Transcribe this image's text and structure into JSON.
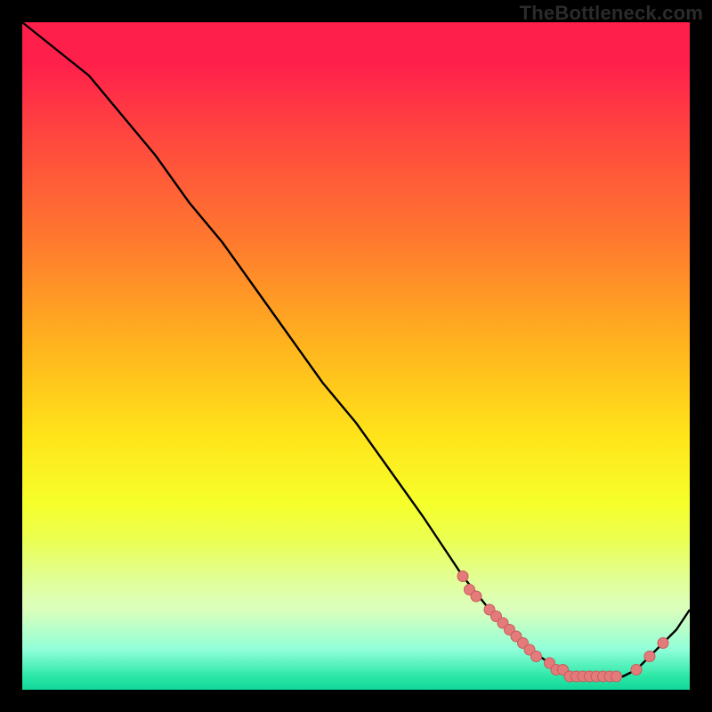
{
  "watermark": "TheBottleneck.com",
  "colors": {
    "curve": "#000000",
    "marker_fill": "#e47b7b",
    "marker_stroke": "#c95c5c"
  },
  "chart_data": {
    "type": "line",
    "title": "",
    "xlabel": "",
    "ylabel": "",
    "xlim": [
      0,
      100
    ],
    "ylim": [
      0,
      100
    ],
    "series": [
      {
        "name": "curve",
        "x": [
          0,
          5,
          10,
          15,
          20,
          25,
          30,
          35,
          40,
          45,
          50,
          55,
          60,
          62,
          66,
          70,
          73,
          76,
          79,
          81,
          84,
          86,
          88,
          90,
          92,
          94,
          96,
          98,
          100
        ],
        "y": [
          100,
          96,
          92,
          86,
          80,
          73,
          67,
          60,
          53,
          46,
          40,
          33,
          26,
          23,
          17,
          12,
          9,
          6,
          4,
          3,
          2,
          2,
          2,
          2,
          3,
          5,
          7,
          9,
          12
        ]
      }
    ],
    "markers": {
      "name": "flat-region-dots",
      "x": [
        66,
        67,
        68,
        70,
        71,
        72,
        73,
        74,
        75,
        76,
        77,
        79,
        80,
        81,
        82,
        83,
        84,
        85,
        86,
        87,
        88,
        89,
        92,
        94,
        96
      ],
      "y": [
        17,
        15,
        14,
        12,
        11,
        10,
        9,
        8,
        7,
        6,
        5,
        4,
        3,
        3,
        2,
        2,
        2,
        2,
        2,
        2,
        2,
        2,
        3,
        5,
        7
      ]
    }
  }
}
